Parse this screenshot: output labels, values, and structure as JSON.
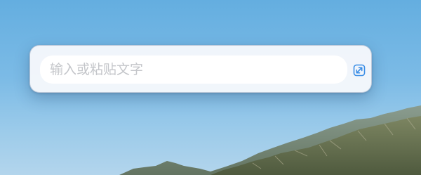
{
  "input": {
    "value": "",
    "placeholder": "输入或粘贴文字"
  },
  "expand_button": {
    "icon": "expand-icon"
  },
  "colors": {
    "accent": "#3a8ee6",
    "placeholder": "#c4c6ca",
    "panel": "#f6f8fc",
    "sky_top": "#64aee0"
  }
}
